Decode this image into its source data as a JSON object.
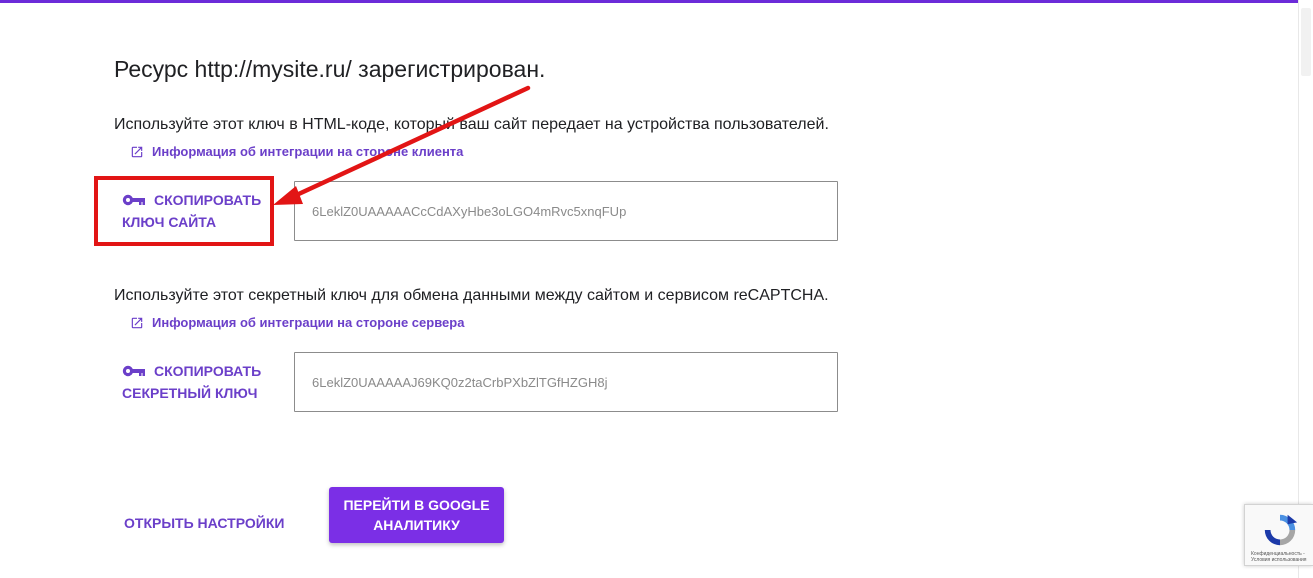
{
  "page": {
    "title": "Ресурс http://mysite.ru/ зарегистрирован."
  },
  "site_key_section": {
    "description": "Используйте этот ключ в HTML-коде, который ваш сайт передает на устройства пользователей.",
    "link_label": "Информация об интеграции на стороне клиента",
    "copy_button_line1": "СКОПИРОВАТЬ",
    "copy_button_line2": "КЛЮЧ САЙТА",
    "key_value": "6LeklZ0UAAAAACcCdAXyHbe3oLGO4mRvc5xnqFUp"
  },
  "secret_key_section": {
    "description": "Используйте этот секретный ключ для обмена данными между сайтом и сервисом reCAPTCHA.",
    "link_label": "Информация об интеграции на стороне сервера",
    "copy_button_line1": "СКОПИРОВАТЬ",
    "copy_button_line2": "СЕКРЕТНЫЙ КЛЮЧ",
    "key_value": "6LeklZ0UAAAAAJ69KQ0z2taCrbPXbZlTGfHZGH8j"
  },
  "footer": {
    "settings_button": "ОТКРЫТЬ НАСТРОЙКИ",
    "ga_button_line1": "ПЕРЕЙТИ В GOOGLE",
    "ga_button_line2": "АНАЛИТИКУ"
  },
  "recaptcha_badge": {
    "text_line1": "Конфиденциальность -",
    "text_line2": "Условия использования"
  },
  "colors": {
    "accent": "#6b3fc9",
    "primary_button": "#7b2fe6",
    "top_bar": "#6c2bd9",
    "annotation_red": "#e21515"
  },
  "icons": {
    "external_link": "open-in-new-icon",
    "key": "key-icon",
    "recaptcha": "recaptcha-logo-icon"
  }
}
